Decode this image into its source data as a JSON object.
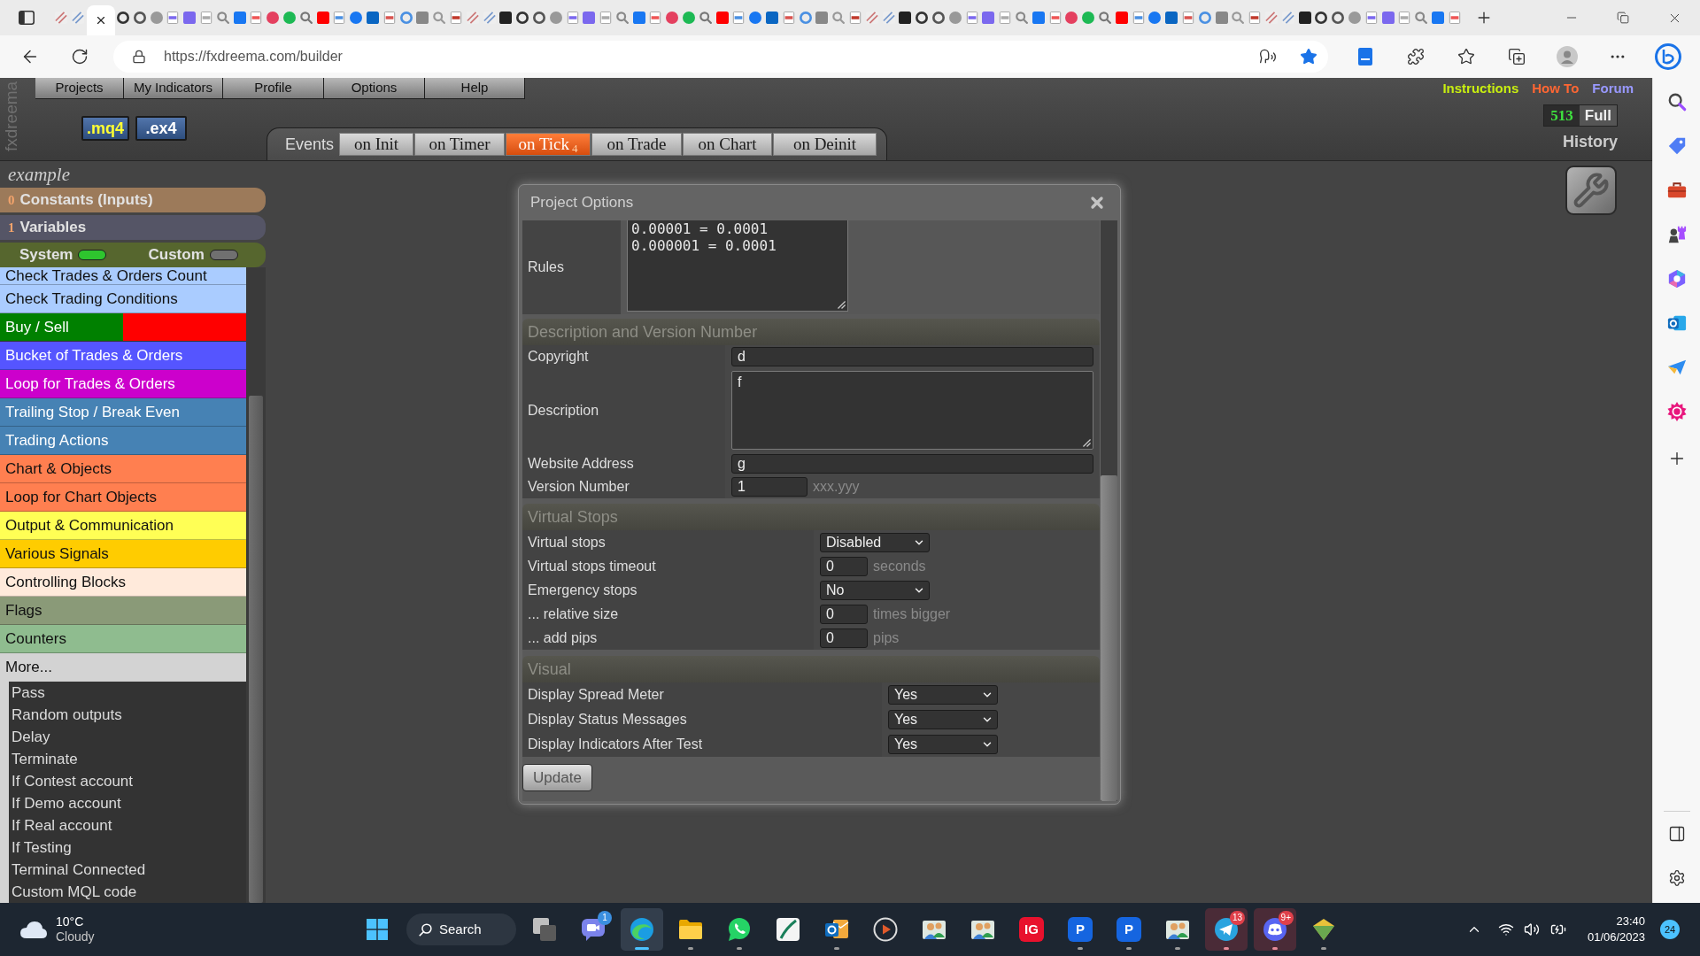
{
  "browser": {
    "tabs": [
      {
        "selected": false
      },
      {
        "selected": false
      },
      {
        "selected": true
      },
      {
        "selected": false
      },
      {
        "selected": false
      },
      {
        "selected": false
      },
      {
        "selected": false
      },
      {
        "selected": false
      },
      {
        "selected": false
      },
      {
        "selected": false
      },
      {
        "selected": false
      },
      {
        "selected": false
      },
      {
        "selected": false
      },
      {
        "selected": false
      },
      {
        "selected": false
      },
      {
        "selected": false
      },
      {
        "selected": false
      },
      {
        "selected": false
      },
      {
        "selected": false
      },
      {
        "selected": false
      },
      {
        "selected": false
      },
      {
        "selected": false
      },
      {
        "selected": false
      },
      {
        "selected": false
      },
      {
        "selected": false
      },
      {
        "selected": false
      },
      {
        "selected": false
      },
      {
        "selected": false
      },
      {
        "selected": false
      },
      {
        "selected": false
      },
      {
        "selected": false
      },
      {
        "selected": false
      },
      {
        "selected": false
      },
      {
        "selected": false
      },
      {
        "selected": false
      },
      {
        "selected": false
      },
      {
        "selected": false
      },
      {
        "selected": false
      },
      {
        "selected": false
      },
      {
        "selected": false
      },
      {
        "selected": false
      },
      {
        "selected": false
      },
      {
        "selected": false
      },
      {
        "selected": false
      },
      {
        "selected": false
      },
      {
        "selected": false
      },
      {
        "selected": false
      },
      {
        "selected": false
      },
      {
        "selected": false
      },
      {
        "selected": false
      },
      {
        "selected": false
      },
      {
        "selected": false
      },
      {
        "selected": false
      },
      {
        "selected": false
      },
      {
        "selected": false
      },
      {
        "selected": false
      },
      {
        "selected": false
      },
      {
        "selected": false
      },
      {
        "selected": false
      },
      {
        "selected": false
      },
      {
        "selected": false
      },
      {
        "selected": false
      },
      {
        "selected": false
      },
      {
        "selected": false
      },
      {
        "selected": false
      },
      {
        "selected": false
      },
      {
        "selected": false
      },
      {
        "selected": false
      },
      {
        "selected": false
      },
      {
        "selected": false
      },
      {
        "selected": false
      },
      {
        "selected": false
      },
      {
        "selected": false
      },
      {
        "selected": false
      },
      {
        "selected": false
      },
      {
        "selected": false
      },
      {
        "selected": false
      },
      {
        "selected": false
      },
      {
        "selected": false
      },
      {
        "selected": false
      },
      {
        "selected": false
      },
      {
        "selected": false
      },
      {
        "selected": false
      },
      {
        "selected": false
      }
    ],
    "url": "https://fxdreema.com/builder"
  },
  "app": {
    "brand": "fxdreema",
    "menu": [
      "Projects",
      "My Indicators",
      "Profile",
      "Options",
      "Help"
    ],
    "top_links": [
      {
        "label": "Instructions",
        "color": "#c8ee10"
      },
      {
        "label": "How To",
        "color": "#ff6633"
      },
      {
        "label": "Forum",
        "color": "#9999ff"
      }
    ],
    "export_buttons": [
      ".mq4",
      ".ex4"
    ],
    "credits": {
      "count": "513",
      "plan": "Full"
    },
    "history": "History",
    "events": {
      "label": "Events",
      "tabs": [
        {
          "label": "on Init",
          "selected": false
        },
        {
          "label": "on Timer",
          "selected": false
        },
        {
          "label": "on Tick",
          "badge": "4",
          "selected": true
        },
        {
          "label": "on Trade",
          "selected": false
        },
        {
          "label": "on Chart",
          "selected": false
        },
        {
          "label": "on Deinit",
          "selected": false
        }
      ]
    },
    "project_name": "example",
    "panels": [
      {
        "count": "0",
        "label": "Constants (Inputs)",
        "color": "#9c7a5a"
      },
      {
        "count": "1",
        "label": "Variables",
        "color": "#555566"
      }
    ],
    "toggles": [
      {
        "label": "System",
        "on": true
      },
      {
        "label": "Custom",
        "on": false
      }
    ],
    "blocks": [
      {
        "kind": "plain",
        "label": "Check Trades & Orders Count",
        "color": "#aaccff"
      },
      {
        "kind": "plain",
        "label": "Check Trading Conditions",
        "color": "#aaccff"
      },
      {
        "kind": "split",
        "label": "Buy / Sell",
        "color": "#008000",
        "right_half": {
          "color": "#ff0000"
        }
      },
      {
        "kind": "plain",
        "label": "Bucket of Trades & Orders",
        "color": "#5555ff"
      },
      {
        "kind": "plain",
        "label": "Loop for Trades & Orders",
        "color": "#cc00cc"
      },
      {
        "kind": "plain",
        "label": "Trailing Stop / Break Even",
        "color": "#4682b4"
      },
      {
        "kind": "plain",
        "label": "Trading Actions",
        "color": "#4682b4"
      },
      {
        "kind": "plain",
        "label": "Chart & Objects",
        "color": "#ff7f50"
      },
      {
        "kind": "plain",
        "label": "Loop for Chart Objects",
        "color": "#ff7f50"
      },
      {
        "kind": "plain",
        "label": "Output & Communication",
        "color": "#ffff55"
      },
      {
        "kind": "plain",
        "label": "Various Signals",
        "color": "#ffcc00"
      },
      {
        "kind": "plain",
        "label": "Controlling Blocks",
        "color": "#ffeadb"
      },
      {
        "kind": "plain",
        "label": "Flags",
        "color": "#8a9a78"
      },
      {
        "kind": "plain",
        "label": "Counters",
        "color": "#8fbc8f"
      }
    ],
    "more": {
      "label": "More...",
      "expanded": true,
      "items": [
        "Pass",
        "Random outputs",
        "Delay",
        "Terminate",
        "If Contest account",
        "If Demo account",
        "If Real account",
        "If Testing",
        "Terminal Connected",
        "Custom MQL code"
      ]
    }
  },
  "dialog": {
    "title": "Project Options",
    "rules": {
      "label": "Rules",
      "lines": [
        "0.00001 = 0.0001",
        "0.000001 = 0.0001"
      ]
    },
    "sections": [
      {
        "title": "Description and Version Number",
        "rows": [
          {
            "kind": "text",
            "label": "Copyright",
            "value": "d"
          },
          {
            "kind": "textarea",
            "label": "Description",
            "value": "f"
          },
          {
            "kind": "text",
            "label": "Website Address",
            "value": "g"
          },
          {
            "kind": "short",
            "label": "Version Number",
            "value": "1",
            "unit": "xxx.yyy"
          }
        ]
      },
      {
        "title": "Virtual Stops",
        "rows": [
          {
            "kind": "select",
            "label": "Virtual stops",
            "value": "Disabled"
          },
          {
            "kind": "short",
            "label": "Virtual stops timeout",
            "value": "0",
            "unit": "seconds"
          },
          {
            "kind": "select",
            "label": "Emergency stops",
            "value": "No"
          },
          {
            "kind": "short",
            "label": "... relative size",
            "value": "0",
            "unit": "times bigger"
          },
          {
            "kind": "short",
            "label": "... add pips",
            "value": "0",
            "unit": "pips"
          }
        ]
      },
      {
        "title": "Visual",
        "rows": [
          {
            "kind": "select",
            "label": "Display Spread Meter",
            "value": "Yes"
          },
          {
            "kind": "select",
            "label": "Display Status Messages",
            "value": "Yes"
          },
          {
            "kind": "select",
            "label": "Display Indicators After Test",
            "value": "Yes"
          }
        ]
      }
    ],
    "button": "Update"
  },
  "taskbar": {
    "weather": {
      "temperature": "10°C",
      "condition": "Cloudy"
    },
    "search_label": "Search",
    "apps": [
      {
        "kind": "windows",
        "running": false,
        "selected": false
      },
      {
        "kind": "video_chat",
        "badge": {
          "text": "1",
          "color": "#3b8fe0"
        },
        "running": false,
        "selected": false
      },
      {
        "kind": "browser",
        "running": true,
        "selected": true
      },
      {
        "kind": "folder",
        "running": true,
        "selected": false
      },
      {
        "kind": "phone_chat",
        "running": true,
        "selected": false
      },
      {
        "kind": "slash",
        "running": false,
        "selected": false
      },
      {
        "kind": "mail",
        "running": true,
        "selected": false
      },
      {
        "kind": "play",
        "running": false,
        "selected": false
      },
      {
        "kind": "people",
        "running": false,
        "selected": false
      },
      {
        "kind": "people",
        "running": false,
        "selected": false
      },
      {
        "kind": "logo",
        "label": "IG",
        "color": "#e8112d",
        "running": false,
        "selected": false
      },
      {
        "kind": "logo",
        "label": "P",
        "color": "#1565e0",
        "running": true,
        "selected": false
      },
      {
        "kind": "logo",
        "label": "P",
        "color": "#1565e0",
        "running": true,
        "selected": false
      },
      {
        "kind": "people",
        "running": true,
        "selected": false
      },
      {
        "kind": "plane",
        "badge": {
          "text": "13",
          "color": "#e0404a"
        },
        "alert": true,
        "running": true,
        "selected": false
      },
      {
        "kind": "controller",
        "badge": {
          "text": "9+",
          "color": "#e0404a"
        },
        "alert": true,
        "running": true,
        "selected": false
      },
      {
        "kind": "gem",
        "running": true,
        "selected": false
      }
    ],
    "clock": {
      "time": "23:40",
      "date": "01/06/2023"
    },
    "notification_count": "24"
  }
}
